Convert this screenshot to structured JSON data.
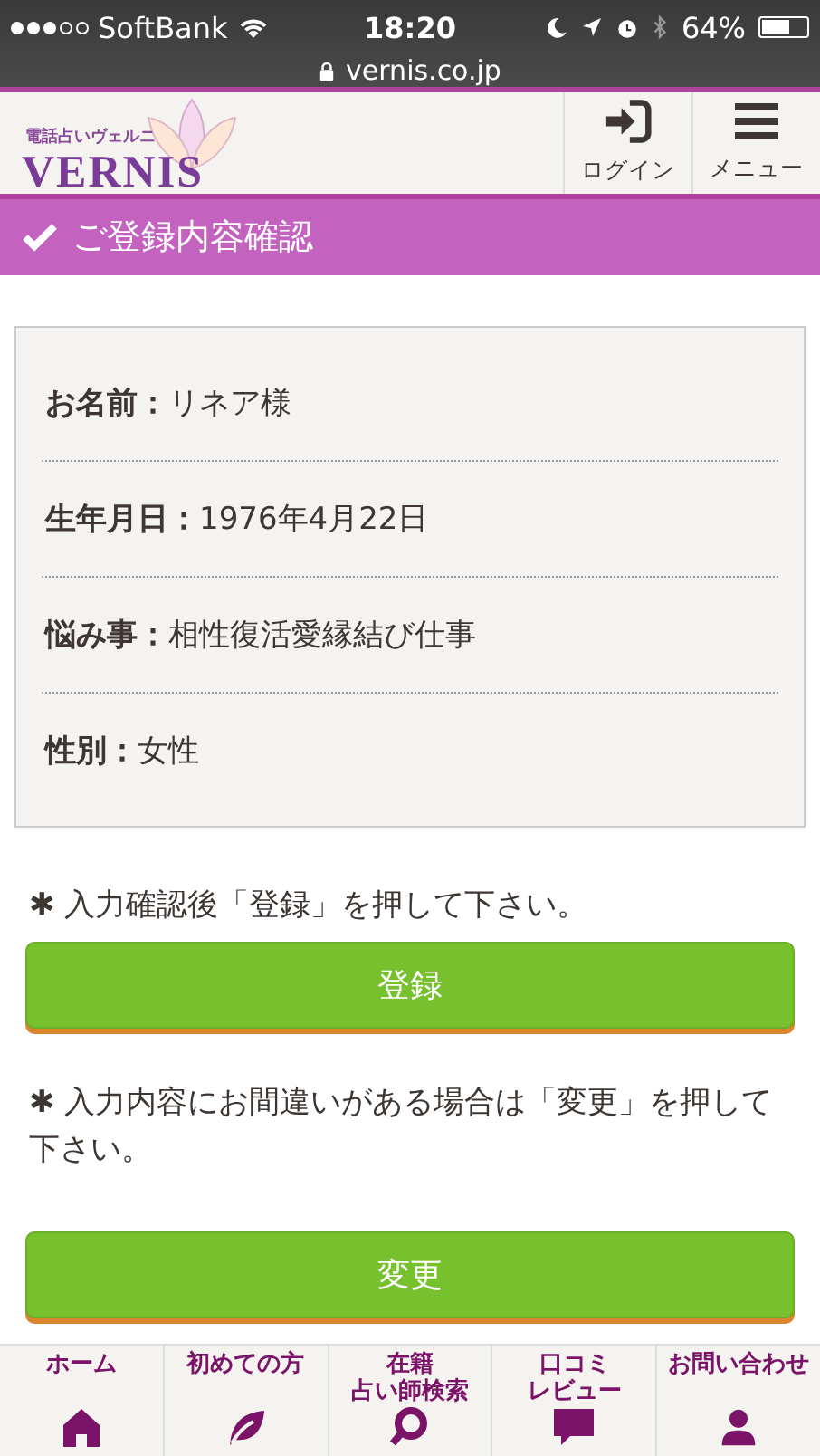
{
  "status_bar": {
    "carrier": "SoftBank",
    "time": "18:20",
    "battery": "64%"
  },
  "address_bar": {
    "url": "vernis.co.jp"
  },
  "header": {
    "logo_tagline": "電話占いヴェルニ",
    "logo_text": "VERNIS",
    "buttons": [
      {
        "label": "ログイン",
        "kind": "login"
      },
      {
        "label": "メニュー",
        "kind": "menu"
      }
    ]
  },
  "page_title": "ご登録内容確認",
  "details": [
    {
      "label": "お名前：",
      "value": "リネア様"
    },
    {
      "label": "生年月日：",
      "value": "1976年4月22日"
    },
    {
      "label": "悩み事：",
      "value": "相性復活愛縁結び仕事"
    },
    {
      "label": "性別：",
      "value": "女性"
    }
  ],
  "actions": [
    {
      "mark": "✱",
      "note": "入力確認後「登録」を押して下さい。",
      "button": "登録"
    },
    {
      "mark": "✱",
      "note": "入力内容にお間違いがある場合は「変更」を押して下さい。",
      "button": "変更"
    }
  ],
  "bottom_nav": [
    {
      "lines": [
        "ホーム"
      ],
      "kind": "home"
    },
    {
      "lines": [
        "初めての方"
      ],
      "kind": "leaf"
    },
    {
      "lines": [
        "在籍",
        "占い師検索"
      ],
      "kind": "search"
    },
    {
      "lines": [
        "口コミ",
        "レビュー"
      ],
      "kind": "chat"
    },
    {
      "lines": [
        "お問い合わせ"
      ],
      "kind": "person"
    }
  ]
}
